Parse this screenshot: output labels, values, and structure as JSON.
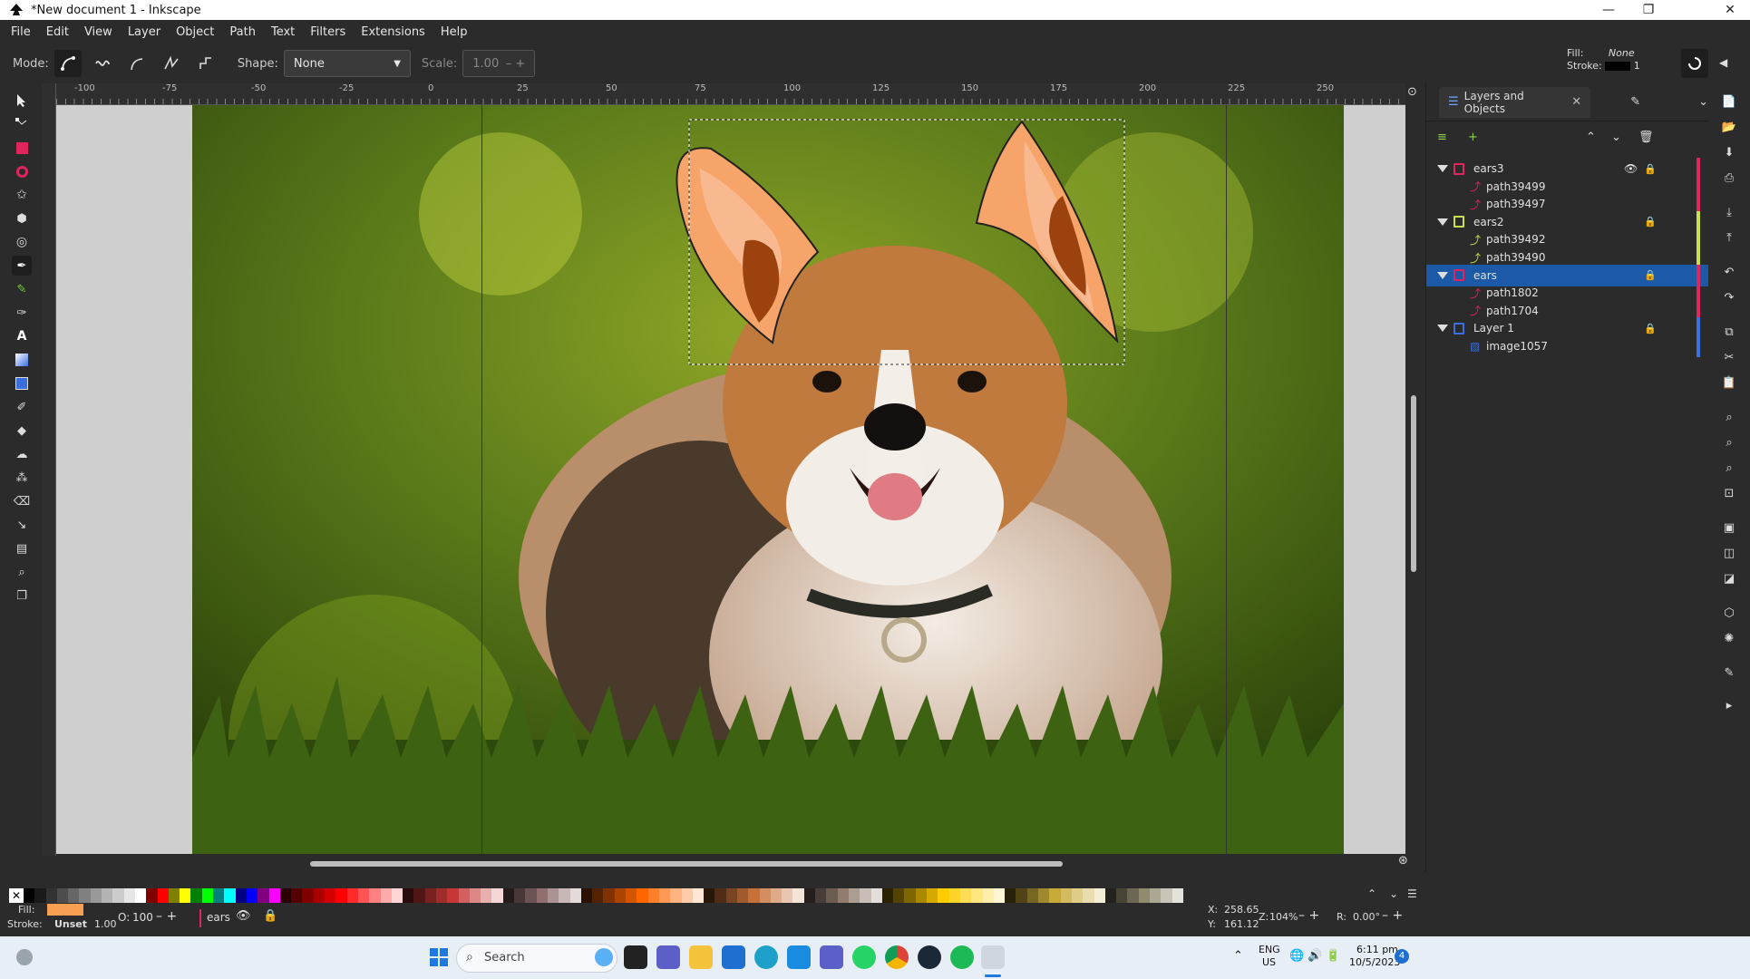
{
  "window": {
    "title": "*New document 1 - Inkscape",
    "minimize": "—",
    "maximize": "❐",
    "close": "✕"
  },
  "menu": [
    "File",
    "Edit",
    "View",
    "Layer",
    "Object",
    "Path",
    "Text",
    "Filters",
    "Extensions",
    "Help"
  ],
  "toolcontrols": {
    "mode_label": "Mode:",
    "shape_label": "Shape:",
    "shape_value": "None",
    "scale_label": "Scale:",
    "scale_value": "1.00",
    "fill_label": "Fill:",
    "fill_value": "None",
    "stroke_label": "Stroke:",
    "stroke_width": "1"
  },
  "ruler": {
    "ticks": [
      "-100",
      "-75",
      "-50",
      "-25",
      "0",
      "25",
      "50",
      "75",
      "100",
      "125",
      "150",
      "175",
      "200",
      "225",
      "250"
    ]
  },
  "panel": {
    "tab_label": "Layers and Objects",
    "rows": [
      {
        "label": "ears3",
        "kind": "layer",
        "color": "#e0245e"
      },
      {
        "label": "path39499",
        "kind": "path",
        "color": "#e0245e"
      },
      {
        "label": "path39497",
        "kind": "path",
        "color": "#e0245e"
      },
      {
        "label": "ears2",
        "kind": "layer",
        "color": "#c8e04a"
      },
      {
        "label": "path39492",
        "kind": "path",
        "color": "#c8e04a"
      },
      {
        "label": "path39490",
        "kind": "path",
        "color": "#c8e04a"
      },
      {
        "label": "ears",
        "kind": "layer",
        "color": "#e0245e",
        "selected": true
      },
      {
        "label": "path1802",
        "kind": "path",
        "color": "#e0245e"
      },
      {
        "label": "path1704",
        "kind": "path",
        "color": "#e0245e"
      },
      {
        "label": "Layer 1",
        "kind": "layer",
        "color": "#3a6fe0"
      },
      {
        "label": "image1057",
        "kind": "image",
        "color": "#3a6fe0"
      }
    ]
  },
  "status": {
    "fill_label": "Fill:",
    "stroke_label": "Stroke:",
    "stroke_value": "Unset",
    "stroke_width": "1.00",
    "opacity_label": "O:",
    "opacity_value": "100",
    "layer_name": "ears",
    "x_label": "X:",
    "x_value": "258.65",
    "y_label": "Y:",
    "y_value": "161.12",
    "zoom_label": "Z:",
    "zoom_value": "104%",
    "rotate_label": "R:",
    "rotate_value": "0.00°"
  },
  "taskbar": {
    "search_placeholder": "Search",
    "lang": "ENG",
    "region": "US",
    "time": "6:11 pm",
    "date": "10/5/2023",
    "notifications": "4"
  },
  "colors": {
    "accent": "#1c59a6",
    "fill_swatch": "#f7a053"
  }
}
